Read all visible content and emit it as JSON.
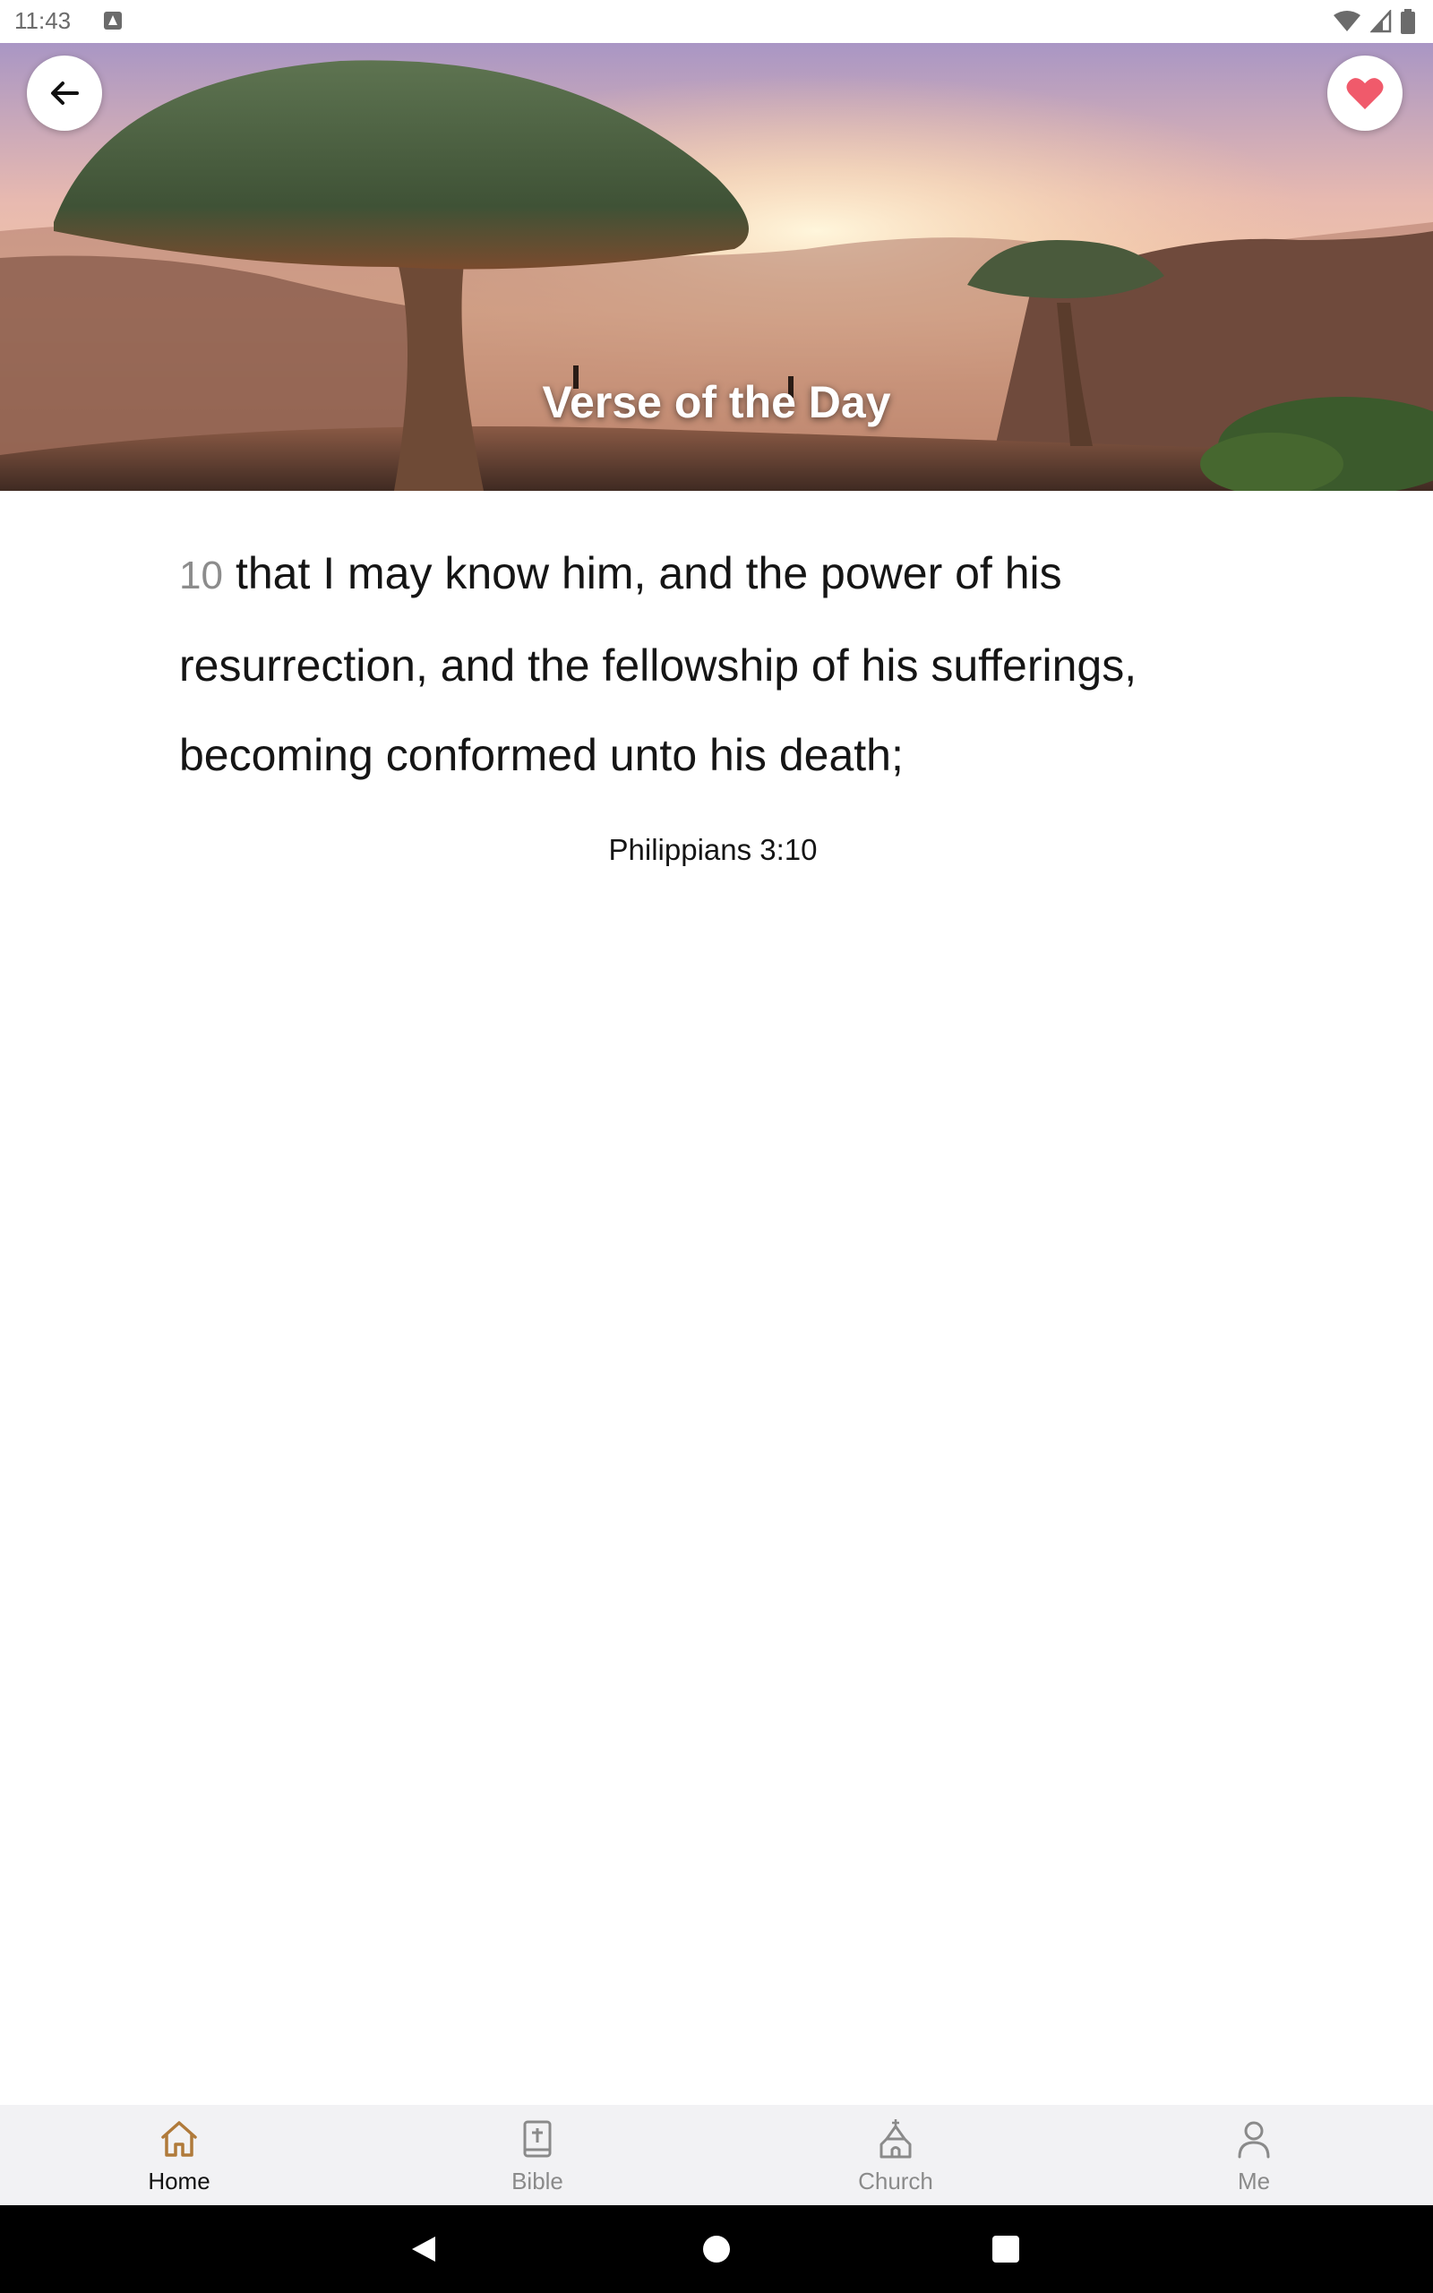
{
  "status_bar": {
    "time": "11:43"
  },
  "hero": {
    "title": "Verse of the Day",
    "back_icon": "arrow-left-icon",
    "favorite_icon": "heart-icon",
    "favorite_color": "#f05a6b"
  },
  "verse": {
    "number": "10",
    "text": "that I may know him, and the power of his resurrection, and the fellowship of his sufferings, becoming conformed unto his death;",
    "reference": "Philippians 3:10"
  },
  "bottom_nav": {
    "active_color": "#b07a3a",
    "items": [
      {
        "label": "Home",
        "icon": "home-icon",
        "active": true
      },
      {
        "label": "Bible",
        "icon": "bible-icon",
        "active": false
      },
      {
        "label": "Church",
        "icon": "church-icon",
        "active": false
      },
      {
        "label": "Me",
        "icon": "person-icon",
        "active": false
      }
    ]
  }
}
